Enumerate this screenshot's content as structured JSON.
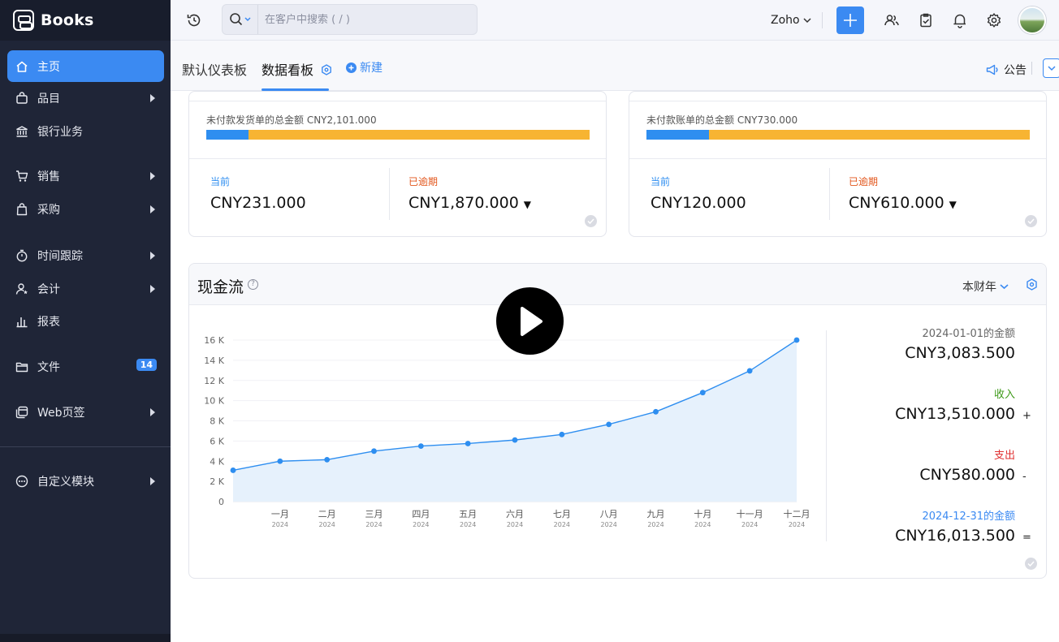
{
  "app": {
    "name": "Books"
  },
  "sidebar": {
    "items": [
      {
        "label": "主页",
        "active": true,
        "arrow": false
      },
      {
        "label": "品目",
        "arrow": true
      },
      {
        "label": "银行业务",
        "arrow": false
      },
      {
        "label": "销售",
        "arrow": true
      },
      {
        "label": "采购",
        "arrow": true
      },
      {
        "label": "时间跟踪",
        "arrow": true
      },
      {
        "label": "会计",
        "arrow": true
      },
      {
        "label": "报表",
        "arrow": false
      },
      {
        "label": "文件",
        "badge": "14"
      },
      {
        "label": "Web页签",
        "arrow": true
      },
      {
        "label": "自定义模块",
        "arrow": true
      }
    ]
  },
  "topbar": {
    "search_placeholder": "在客户中搜索 ( / )",
    "org_name": "Zoho",
    "icons": [
      "history-icon",
      "search-icon",
      "add-icon",
      "users-icon",
      "tasks-icon",
      "bell-icon",
      "gear-icon",
      "avatar"
    ]
  },
  "tabs": {
    "items": [
      "默认仪表板",
      "数据看板"
    ],
    "active_index": 1,
    "new_label": "新建",
    "announcement_label": "公告"
  },
  "receivables": {
    "total_label": "未付款发货单的总金额 CNY2,101.000",
    "progress_fraction": 0.11,
    "current_label": "当前",
    "current_value": "CNY231.000",
    "overdue_label": "已逾期",
    "overdue_value": "CNY1,870.000"
  },
  "payables": {
    "total_label": "未付款账单的总金额 CNY730.000",
    "progress_fraction": 0.164,
    "current_label": "当前",
    "current_value": "CNY120.000",
    "overdue_label": "已逾期",
    "overdue_value": "CNY610.000"
  },
  "cashflow": {
    "title": "现金流",
    "period_label": "本财年",
    "opening_label": "2024-01-01的金额",
    "opening_value": "CNY3,083.500",
    "income_label": "收入",
    "income_value": "CNY13,510.000",
    "income_op": "+",
    "expense_label": "支出",
    "expense_value": "CNY580.000",
    "expense_op": "-",
    "closing_label": "2024-12-31的金额",
    "closing_value": "CNY16,013.500",
    "closing_op": "="
  },
  "colors": {
    "accent": "#3b8af2",
    "overdue": "#e2561c",
    "current": "#2e8ef0",
    "income": "#3f9a1a",
    "expense": "#e03131",
    "progress_fill": "#2e8ef0",
    "progress_rest": "#f7b432"
  },
  "chart_data": {
    "type": "area",
    "title": "",
    "xlabel": "",
    "ylabel": "",
    "y_tick_labels": [
      "0",
      "2 K",
      "4 K",
      "6 K",
      "8 K",
      "10 K",
      "12 K",
      "14 K",
      "16 K"
    ],
    "ylim": [
      0,
      16000
    ],
    "categories": [
      "一月",
      "二月",
      "三月",
      "四月",
      "五月",
      "六月",
      "七月",
      "八月",
      "九月",
      "十月",
      "十一月",
      "十二月"
    ],
    "category_sublabel": "2024",
    "series": [
      {
        "values": [
          3100,
          4000,
          4150,
          5000,
          5500,
          5750,
          6100,
          6650,
          7650,
          8900,
          10800,
          12950,
          16000
        ]
      }
    ],
    "grid": true,
    "legend": "none"
  }
}
